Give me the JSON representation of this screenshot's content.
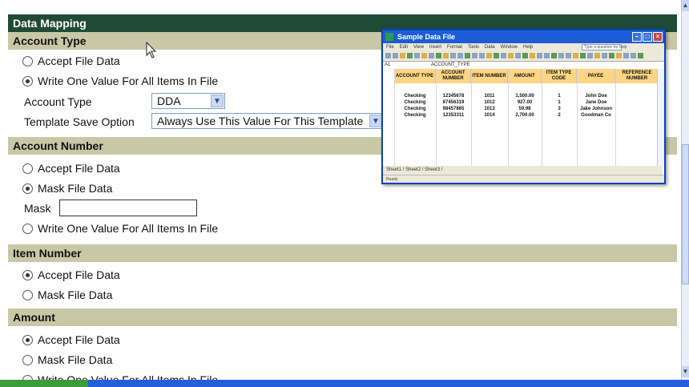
{
  "title": "Data Mapping",
  "account_type": {
    "header": "Account Type",
    "accept": "Accept File Data",
    "write_one": "Write One Value For All Items In File",
    "label": "Account Type",
    "selected": "DDA",
    "template_label": "Template Save Option",
    "template_selected": "Always Use This Value For This Template"
  },
  "account_number": {
    "header": "Account Number",
    "accept": "Accept File Data",
    "mask_file": "Mask File Data",
    "mask_label": "Mask",
    "mask_value": "",
    "write_one": "Write One Value For All Items In File"
  },
  "item_number": {
    "header": "Item Number",
    "accept": "Accept File Data",
    "mask_file": "Mask File Data"
  },
  "amount": {
    "header": "Amount",
    "accept": "Accept File Data",
    "mask_file": "Mask File Data",
    "write_one": "Write One Value For All Items In File"
  },
  "spreadsheet": {
    "title": "Sample Data File",
    "menu": [
      "File",
      "Edit",
      "View",
      "Insert",
      "Format",
      "Tools",
      "Data",
      "Window",
      "Help"
    ],
    "help_box": "Type a question for help",
    "name_box": "A1",
    "formula": "ACCOUNT_TYPE",
    "columns": [
      "ACCOUNT TYPE",
      "ACCOUNT NUMBER",
      "ITEM NUMBER",
      "AMOUNT",
      "ITEM TYPE CODE",
      "PAYEE",
      "REFERENCE NUMBER"
    ],
    "rows": [
      [
        "Checking",
        "12345678",
        "1011",
        "1,500.00",
        "1",
        "John Doe",
        ""
      ],
      [
        "Checking",
        "87456319",
        "1012",
        "927.00",
        "1",
        "Jane Doe",
        ""
      ],
      [
        "Checking",
        "98457865",
        "1013",
        "59.98",
        "3",
        "Jake Johnson",
        ""
      ],
      [
        "Checking",
        "12353311",
        "1014",
        "2,700.00",
        "2",
        "Goodman Co",
        ""
      ]
    ],
    "sheet_tabs": "Sheet1 / Sheet2 / Sheet3 /",
    "status": "Ready"
  },
  "colors": {
    "title_bg": "#1f4b34",
    "section_bg": "#c9c8a6",
    "xp_blue": "#1c5cd8",
    "header_gold": "#fcd582"
  }
}
